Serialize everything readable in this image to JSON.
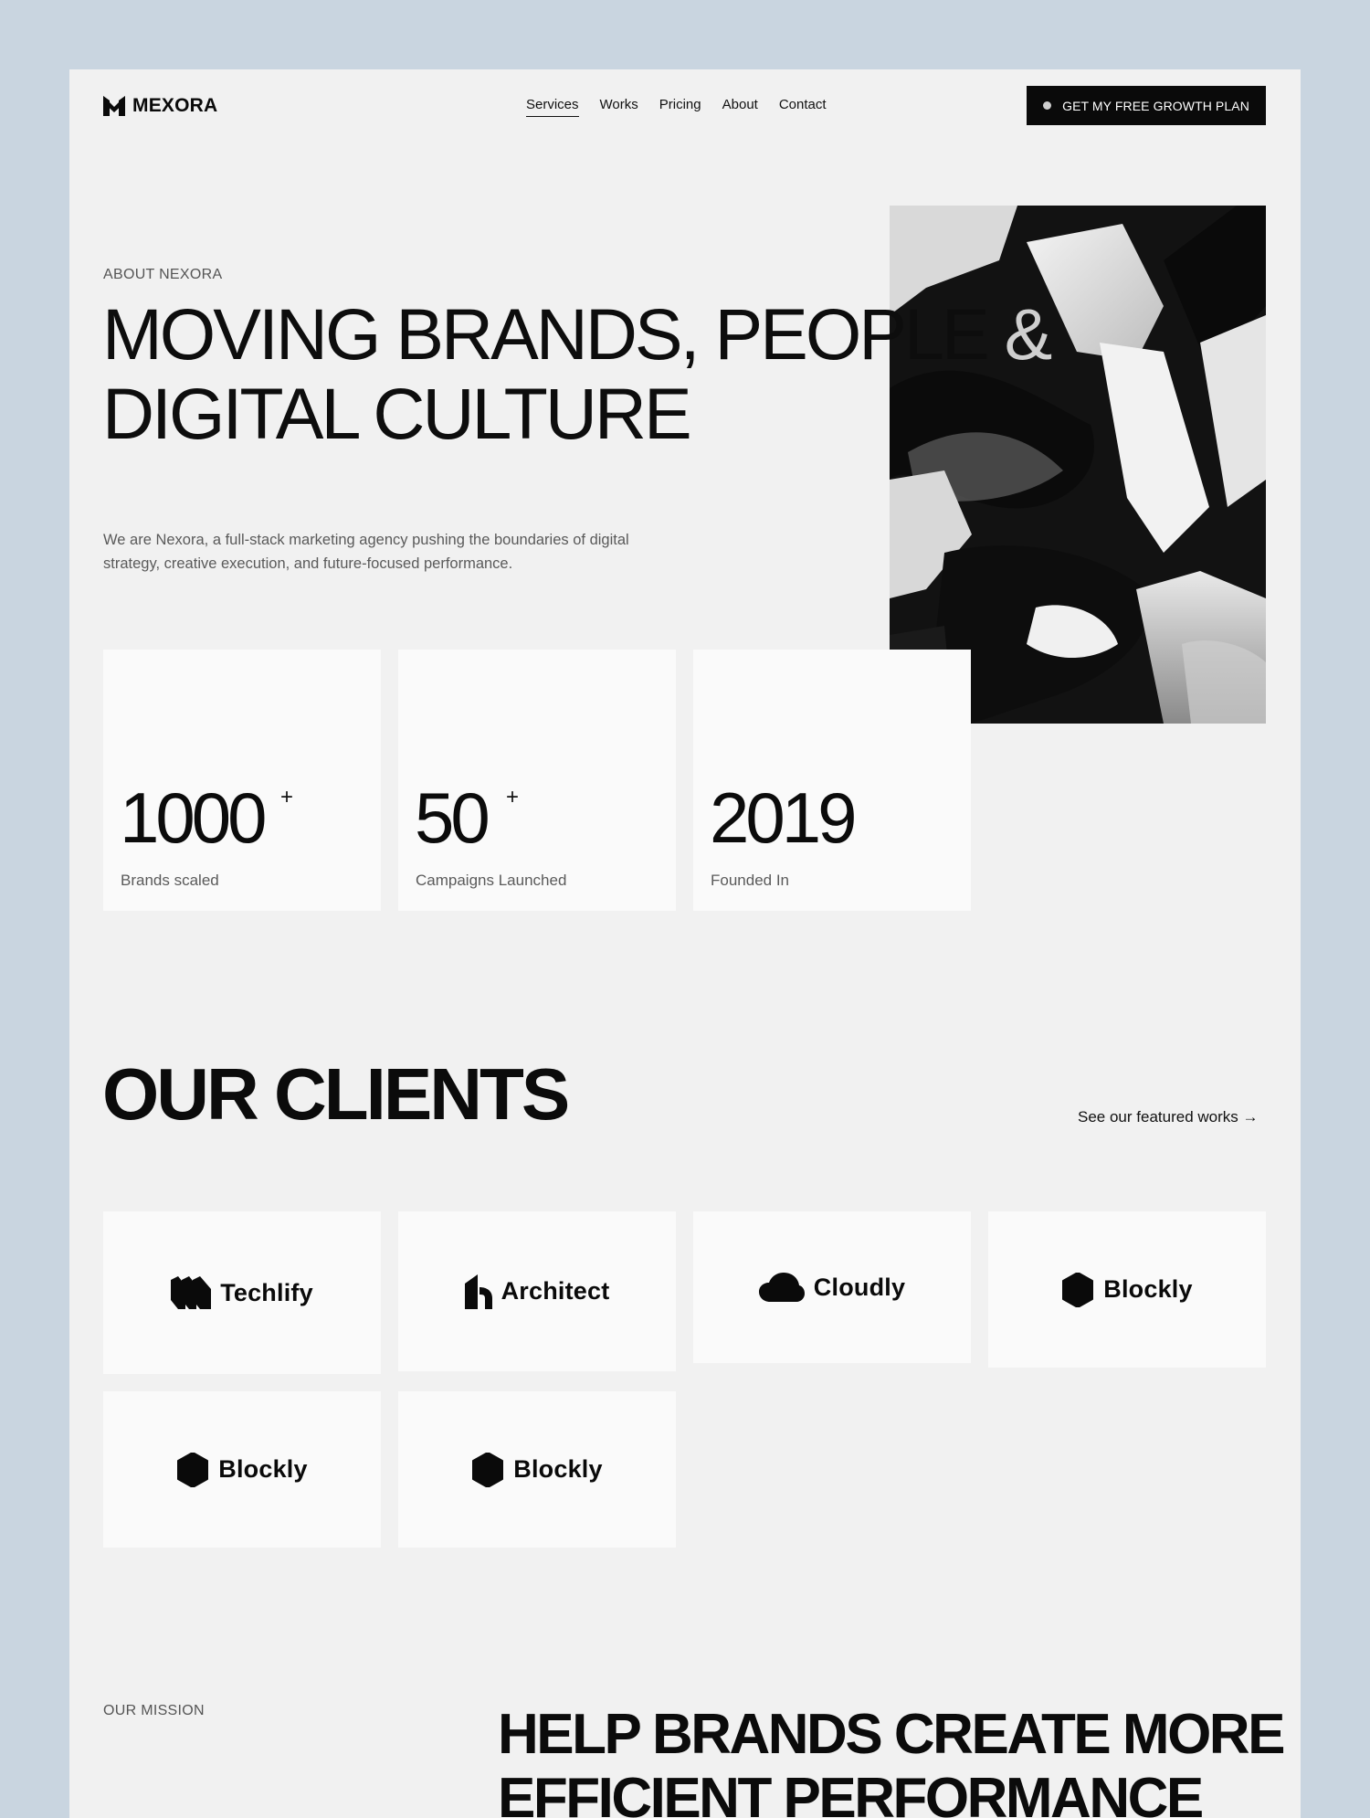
{
  "brand": {
    "name": "MEXORA",
    "icon": "m-logo-icon"
  },
  "nav": {
    "items": [
      {
        "label": "Services",
        "active": true
      },
      {
        "label": "Works",
        "active": false
      },
      {
        "label": "Pricing",
        "active": false
      },
      {
        "label": "About",
        "active": false
      },
      {
        "label": "Contact",
        "active": false
      }
    ],
    "cta_label": "GET MY FREE GROWTH PLAN"
  },
  "hero": {
    "eyebrow": "ABOUT NEXORA",
    "title_line1_a": "MOVING BRANDS, PEOPLE",
    "title_line1_b": "&",
    "title_line2": "DIGITAL CULTURE",
    "description": "We are Nexora, a full-stack marketing agency pushing the boundaries of digital strategy, creative execution, and future-focused performance."
  },
  "stats": [
    {
      "value": "1000",
      "suffix": "+",
      "label": "Brands scaled"
    },
    {
      "value": "50",
      "suffix": "+",
      "label": "Campaigns Launched"
    },
    {
      "value": "2019",
      "suffix": "",
      "label": "Founded In"
    }
  ],
  "clients": {
    "title": "OUR CLIENTS",
    "link_label": "See our featured works →",
    "logos": [
      {
        "name": "Techlify",
        "icon": "techlify-logo-icon"
      },
      {
        "name": "Architect",
        "icon": "architect-logo-icon"
      },
      {
        "name": "Cloudly",
        "icon": "cloud-logo-icon"
      },
      {
        "name": "Blockly",
        "icon": "hexagon-logo-icon"
      },
      {
        "name": "Blockly",
        "icon": "hexagon-logo-icon"
      },
      {
        "name": "Blockly",
        "icon": "hexagon-logo-icon"
      }
    ]
  },
  "mission": {
    "eyebrow": "OUR MISSION",
    "title_line1": "HELP BRANDS CREATE MORE",
    "title_line2": "EFFICIENT PERFORMANCE"
  },
  "colors": {
    "background": "#c9d5e0",
    "page": "#f1f1f1",
    "card": "#fafafa",
    "text": "#0f0f0f",
    "muted": "#5a5a5a",
    "cta": "#0a0a0a"
  }
}
